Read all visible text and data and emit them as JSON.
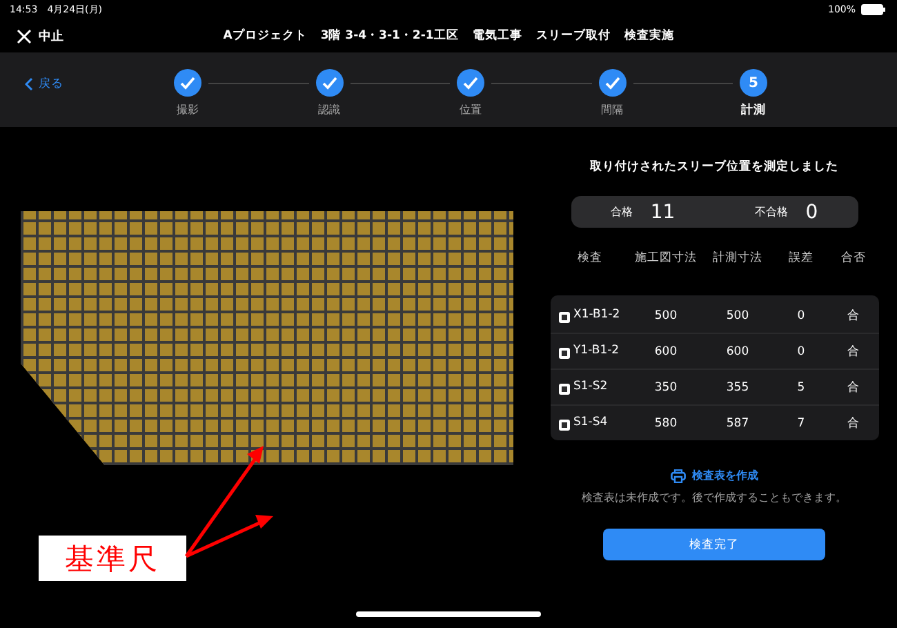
{
  "status_bar": {
    "time": "14:53",
    "date": "4月24日(月)",
    "battery": "100%"
  },
  "header": {
    "close_label": "中止",
    "title_parts": [
      "Aプロジェクト",
      "3階 3-4・3-1・2-1工区",
      "電気工事",
      "スリーブ取付",
      "検査実施"
    ]
  },
  "stepper": {
    "back_label": "戻る",
    "steps": [
      {
        "label": "撮影",
        "done": true,
        "selected": false
      },
      {
        "label": "認識",
        "done": true,
        "selected": false
      },
      {
        "label": "位置",
        "done": true,
        "selected": false
      },
      {
        "label": "間隔",
        "done": true,
        "selected": false
      },
      {
        "label": "計測",
        "number": "5",
        "done": false,
        "selected": true
      }
    ]
  },
  "result": {
    "message": "取り付けされたスリーブ位置を測定しました",
    "pass_label": "合格",
    "pass_count": "11",
    "fail_label": "不合格",
    "fail_count": "0"
  },
  "table": {
    "columns": [
      "検査",
      "施工図寸法",
      "計測寸法",
      "誤差",
      "合否"
    ],
    "rows": [
      {
        "cells": [
          "X1-B1-2",
          "500",
          "500",
          "0",
          "合"
        ]
      },
      {
        "cells": [
          "Y1-B1-2",
          "600",
          "600",
          "0",
          "合"
        ]
      },
      {
        "cells": [
          "S1-S2",
          "350",
          "355",
          "5",
          "合"
        ]
      },
      {
        "cells": [
          "S1-S4",
          "580",
          "587",
          "7",
          "合"
        ]
      }
    ]
  },
  "create_link": "検査表を作成",
  "note": "検査表は未作成です。後で作成することもできます。",
  "complete_button": "検査完了",
  "callout": {
    "text": "基準尺"
  }
}
